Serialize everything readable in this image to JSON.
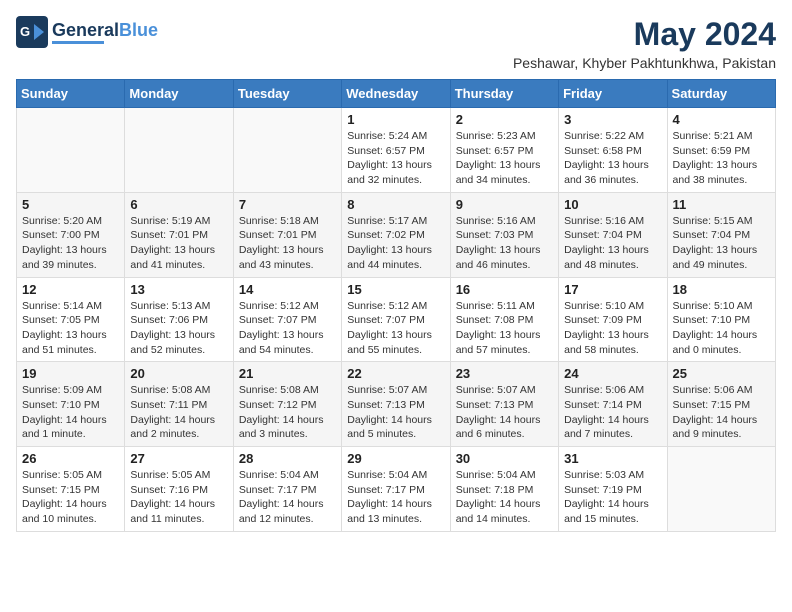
{
  "header": {
    "logo_general": "General",
    "logo_blue": "Blue",
    "month_year": "May 2024",
    "location": "Peshawar, Khyber Pakhtunkhwa, Pakistan"
  },
  "days_of_week": [
    "Sunday",
    "Monday",
    "Tuesday",
    "Wednesday",
    "Thursday",
    "Friday",
    "Saturday"
  ],
  "weeks": [
    [
      {
        "day": "",
        "info": ""
      },
      {
        "day": "",
        "info": ""
      },
      {
        "day": "",
        "info": ""
      },
      {
        "day": "1",
        "info": "Sunrise: 5:24 AM\nSunset: 6:57 PM\nDaylight: 13 hours\nand 32 minutes."
      },
      {
        "day": "2",
        "info": "Sunrise: 5:23 AM\nSunset: 6:57 PM\nDaylight: 13 hours\nand 34 minutes."
      },
      {
        "day": "3",
        "info": "Sunrise: 5:22 AM\nSunset: 6:58 PM\nDaylight: 13 hours\nand 36 minutes."
      },
      {
        "day": "4",
        "info": "Sunrise: 5:21 AM\nSunset: 6:59 PM\nDaylight: 13 hours\nand 38 minutes."
      }
    ],
    [
      {
        "day": "5",
        "info": "Sunrise: 5:20 AM\nSunset: 7:00 PM\nDaylight: 13 hours\nand 39 minutes."
      },
      {
        "day": "6",
        "info": "Sunrise: 5:19 AM\nSunset: 7:01 PM\nDaylight: 13 hours\nand 41 minutes."
      },
      {
        "day": "7",
        "info": "Sunrise: 5:18 AM\nSunset: 7:01 PM\nDaylight: 13 hours\nand 43 minutes."
      },
      {
        "day": "8",
        "info": "Sunrise: 5:17 AM\nSunset: 7:02 PM\nDaylight: 13 hours\nand 44 minutes."
      },
      {
        "day": "9",
        "info": "Sunrise: 5:16 AM\nSunset: 7:03 PM\nDaylight: 13 hours\nand 46 minutes."
      },
      {
        "day": "10",
        "info": "Sunrise: 5:16 AM\nSunset: 7:04 PM\nDaylight: 13 hours\nand 48 minutes."
      },
      {
        "day": "11",
        "info": "Sunrise: 5:15 AM\nSunset: 7:04 PM\nDaylight: 13 hours\nand 49 minutes."
      }
    ],
    [
      {
        "day": "12",
        "info": "Sunrise: 5:14 AM\nSunset: 7:05 PM\nDaylight: 13 hours\nand 51 minutes."
      },
      {
        "day": "13",
        "info": "Sunrise: 5:13 AM\nSunset: 7:06 PM\nDaylight: 13 hours\nand 52 minutes."
      },
      {
        "day": "14",
        "info": "Sunrise: 5:12 AM\nSunset: 7:07 PM\nDaylight: 13 hours\nand 54 minutes."
      },
      {
        "day": "15",
        "info": "Sunrise: 5:12 AM\nSunset: 7:07 PM\nDaylight: 13 hours\nand 55 minutes."
      },
      {
        "day": "16",
        "info": "Sunrise: 5:11 AM\nSunset: 7:08 PM\nDaylight: 13 hours\nand 57 minutes."
      },
      {
        "day": "17",
        "info": "Sunrise: 5:10 AM\nSunset: 7:09 PM\nDaylight: 13 hours\nand 58 minutes."
      },
      {
        "day": "18",
        "info": "Sunrise: 5:10 AM\nSunset: 7:10 PM\nDaylight: 14 hours\nand 0 minutes."
      }
    ],
    [
      {
        "day": "19",
        "info": "Sunrise: 5:09 AM\nSunset: 7:10 PM\nDaylight: 14 hours\nand 1 minute."
      },
      {
        "day": "20",
        "info": "Sunrise: 5:08 AM\nSunset: 7:11 PM\nDaylight: 14 hours\nand 2 minutes."
      },
      {
        "day": "21",
        "info": "Sunrise: 5:08 AM\nSunset: 7:12 PM\nDaylight: 14 hours\nand 3 minutes."
      },
      {
        "day": "22",
        "info": "Sunrise: 5:07 AM\nSunset: 7:13 PM\nDaylight: 14 hours\nand 5 minutes."
      },
      {
        "day": "23",
        "info": "Sunrise: 5:07 AM\nSunset: 7:13 PM\nDaylight: 14 hours\nand 6 minutes."
      },
      {
        "day": "24",
        "info": "Sunrise: 5:06 AM\nSunset: 7:14 PM\nDaylight: 14 hours\nand 7 minutes."
      },
      {
        "day": "25",
        "info": "Sunrise: 5:06 AM\nSunset: 7:15 PM\nDaylight: 14 hours\nand 9 minutes."
      }
    ],
    [
      {
        "day": "26",
        "info": "Sunrise: 5:05 AM\nSunset: 7:15 PM\nDaylight: 14 hours\nand 10 minutes."
      },
      {
        "day": "27",
        "info": "Sunrise: 5:05 AM\nSunset: 7:16 PM\nDaylight: 14 hours\nand 11 minutes."
      },
      {
        "day": "28",
        "info": "Sunrise: 5:04 AM\nSunset: 7:17 PM\nDaylight: 14 hours\nand 12 minutes."
      },
      {
        "day": "29",
        "info": "Sunrise: 5:04 AM\nSunset: 7:17 PM\nDaylight: 14 hours\nand 13 minutes."
      },
      {
        "day": "30",
        "info": "Sunrise: 5:04 AM\nSunset: 7:18 PM\nDaylight: 14 hours\nand 14 minutes."
      },
      {
        "day": "31",
        "info": "Sunrise: 5:03 AM\nSunset: 7:19 PM\nDaylight: 14 hours\nand 15 minutes."
      },
      {
        "day": "",
        "info": ""
      }
    ]
  ]
}
